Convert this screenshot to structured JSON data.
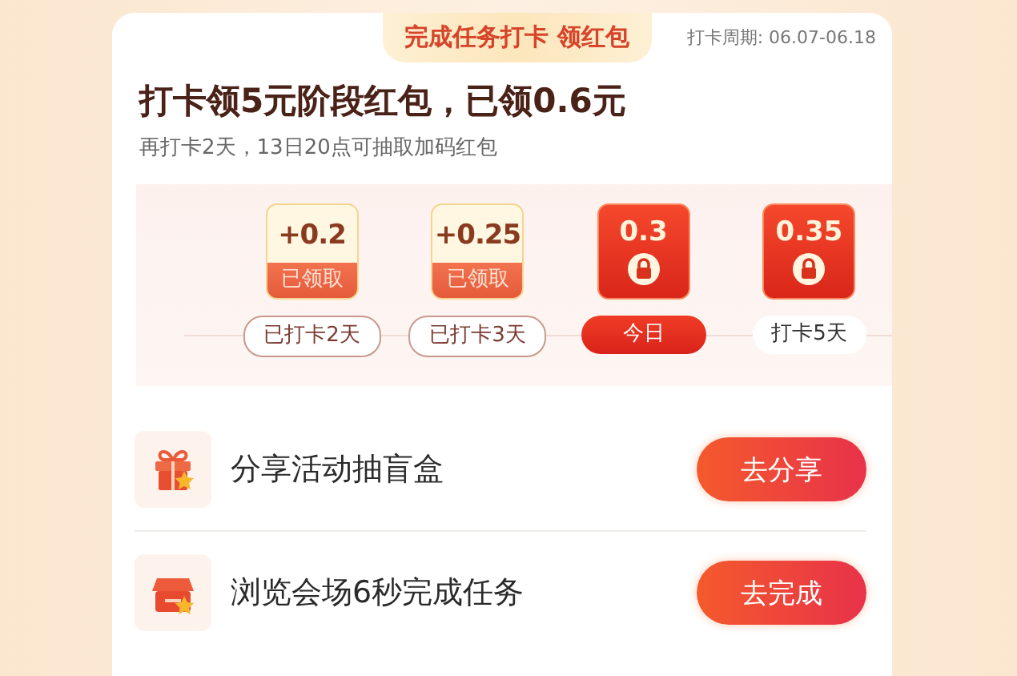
{
  "header": {
    "badge": "完成任务打卡 领红包",
    "period": "打卡周期: 06.07-06.18"
  },
  "title": "打卡领5元阶段红包，已领0.6元",
  "subtitle": "再打卡2天，13日20点可抽取加码红包",
  "days": [
    {
      "kind": "claimed",
      "amount": "+0.2",
      "status": "已领取",
      "label": "已打卡2天"
    },
    {
      "kind": "claimed",
      "amount": "+0.25",
      "status": "已领取",
      "label": "已打卡3天"
    },
    {
      "kind": "today",
      "amount": "0.3",
      "label": "今日"
    },
    {
      "kind": "future",
      "amount": "0.35",
      "label": "打卡5天"
    }
  ],
  "tasks": [
    {
      "kind": "gift",
      "title": "分享活动抽盲盒",
      "button": "去分享"
    },
    {
      "kind": "shop",
      "title": "浏览会场6秒完成任务",
      "button": "去完成"
    }
  ]
}
